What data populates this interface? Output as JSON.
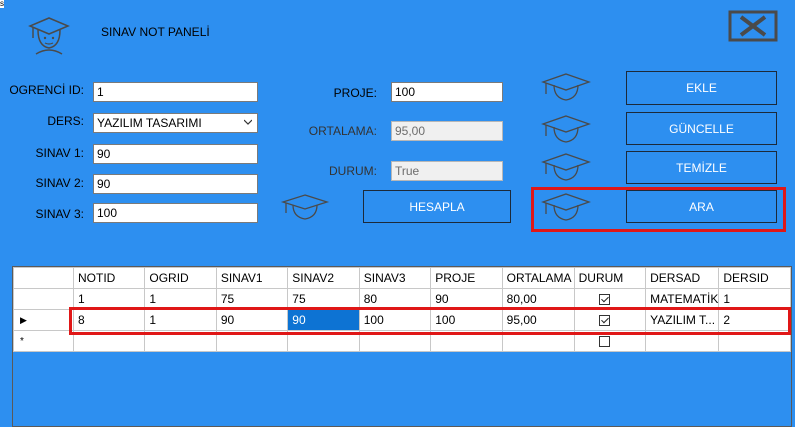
{
  "window": {
    "title": "SINAV NOT PANELİ"
  },
  "corner_text": "s",
  "form": {
    "ogrenci_id": {
      "label": "OGRENCİ ID:",
      "value": "1"
    },
    "ders": {
      "label": "DERS:",
      "value": "YAZILIM TASARIMI"
    },
    "sinav1": {
      "label": "SINAV 1:",
      "value": "90"
    },
    "sinav2": {
      "label": "SINAV 2:",
      "value": "90"
    },
    "sinav3": {
      "label": "SINAV 3:",
      "value": "100"
    },
    "proje": {
      "label": "PROJE:",
      "value": "100"
    },
    "ortalama": {
      "label": "ORTALAMA:",
      "value": "95,00"
    },
    "durum": {
      "label": "DURUM:",
      "value": "True"
    }
  },
  "buttons": {
    "ekle": "EKLE",
    "guncelle": "GÜNCELLE",
    "temizle": "TEMİZLE",
    "hesapla": "HESAPLA",
    "ara": "ARA"
  },
  "grid": {
    "columns": [
      "NOTID",
      "OGRID",
      "SINAV1",
      "SINAV2",
      "SINAV3",
      "PROJE",
      "ORTALAMA",
      "DURUM",
      "DERSAD",
      "DERSID"
    ],
    "rows": [
      {
        "notid": "1",
        "ogrid": "1",
        "sinav1": "75",
        "sinav2": "75",
        "sinav3": "80",
        "proje": "90",
        "ortalama": "80,00",
        "durum": true,
        "dersad": "MATEMATİK",
        "dersid": "1"
      },
      {
        "notid": "8",
        "ogrid": "1",
        "sinav1": "90",
        "sinav2": "90",
        "sinav3": "100",
        "proje": "100",
        "ortalama": "95,00",
        "durum": true,
        "dersad": "YAZILIM T...",
        "dersid": "2"
      }
    ],
    "current_row_marker": "▶",
    "new_row_marker": "*"
  },
  "colors": {
    "background": "#2d8ff0",
    "highlight": "#e01717",
    "selected_cell": "#0d73d3"
  }
}
